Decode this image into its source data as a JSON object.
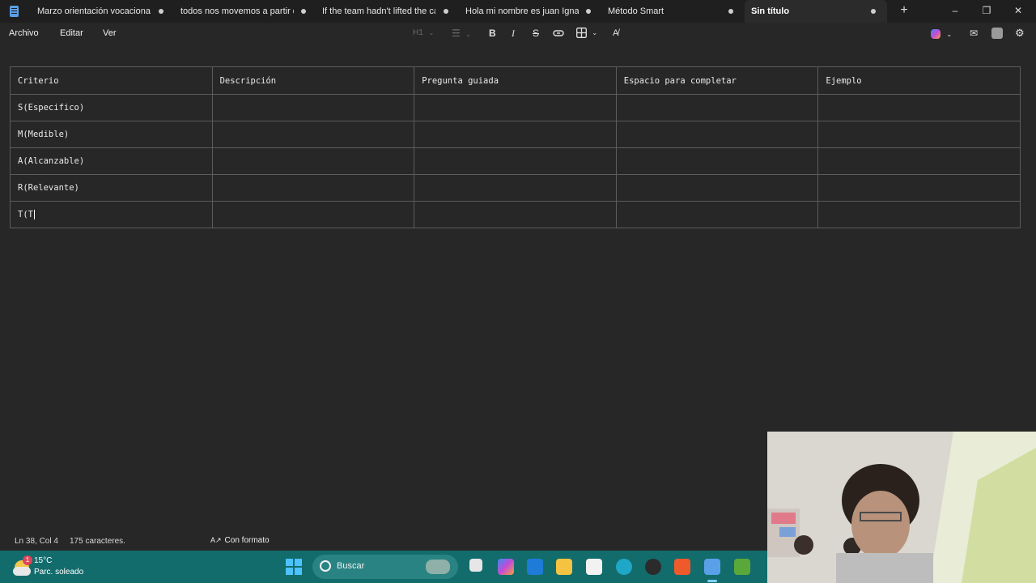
{
  "tabs": [
    {
      "label": "Marzo orientación vocacional, ."
    },
    {
      "label": "todos nos movemos a partir de"
    },
    {
      "label": "If the team hadn't lifted the car"
    },
    {
      "label": "Hola mi nombre es juan Ignacio"
    },
    {
      "label": "Método Smart"
    },
    {
      "label": "Sin título"
    }
  ],
  "menu": {
    "archivo": "Archivo",
    "editar": "Editar",
    "ver": "Ver"
  },
  "toolbar": {
    "heading": "H1"
  },
  "table": {
    "headers": [
      "Criterio",
      "Descripción",
      "Pregunta guiada",
      "Espacio para completar",
      "Ejemplo"
    ],
    "rows": [
      [
        "S(Especifico)",
        "",
        "",
        "",
        ""
      ],
      [
        "M(Medible)",
        "",
        "",
        "",
        ""
      ],
      [
        "A(Alcanzable)",
        "",
        "",
        "",
        ""
      ],
      [
        "R(Relevante)",
        "",
        "",
        "",
        ""
      ],
      [
        "T(T",
        "",
        "",
        "",
        ""
      ]
    ]
  },
  "status": {
    "position": "Ln 38, Col 4",
    "chars": "175 caracteres.",
    "format": "Con formato"
  },
  "taskbar": {
    "weather_temp": "15°C",
    "weather_desc": "Parc. soleado",
    "weather_badge": "1",
    "search": "Buscar"
  },
  "colors": {
    "taskbar": "#136c6c",
    "background": "#272727",
    "titlebar": "#1f1f1f"
  }
}
